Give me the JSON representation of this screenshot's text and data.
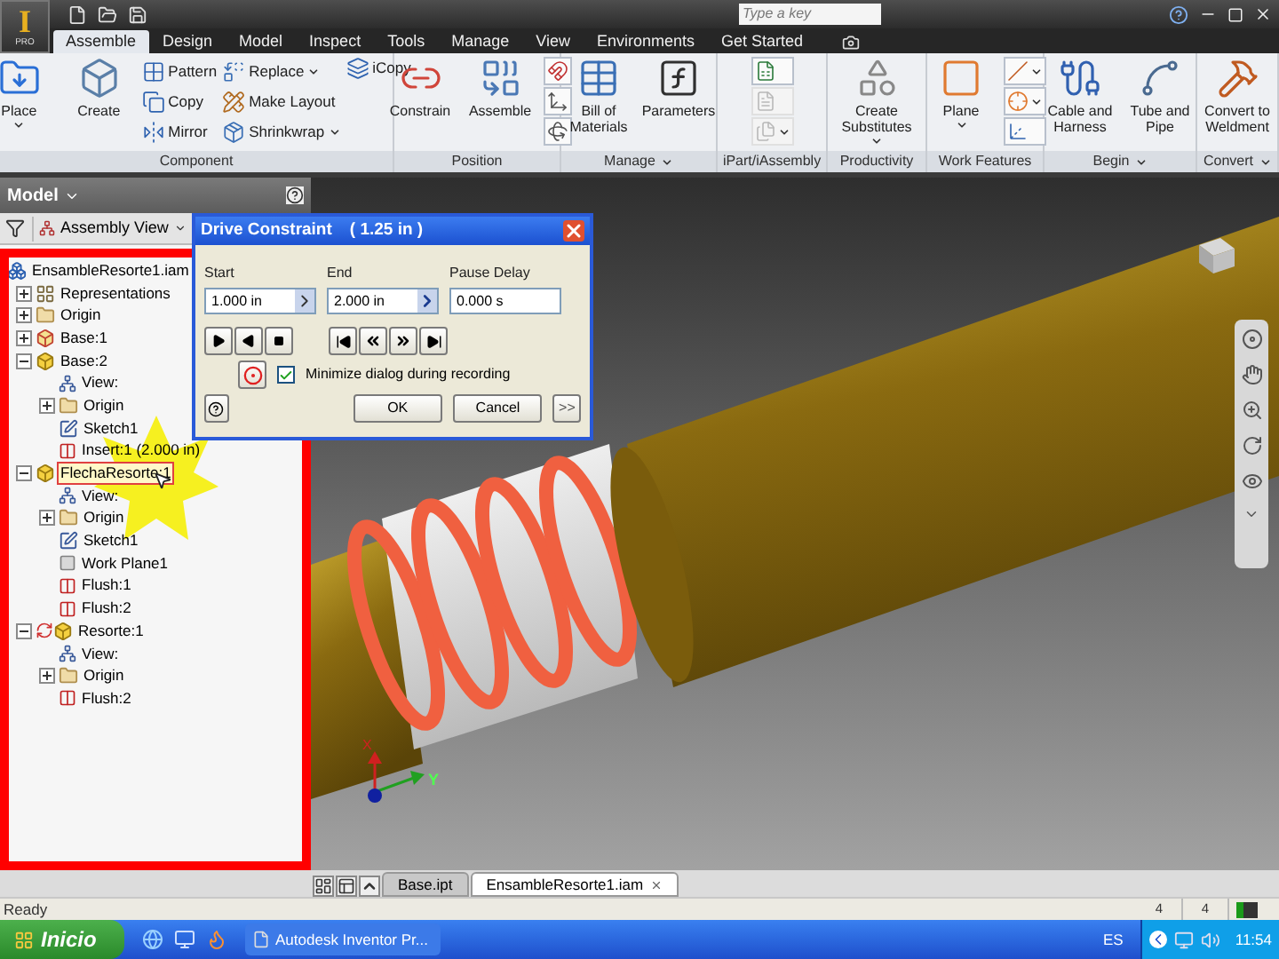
{
  "title_bar": {
    "app_button": {
      "letter": "I",
      "edition": "PRO"
    },
    "search": {
      "placeholder": "Type a key"
    }
  },
  "ribbon_tabs": [
    {
      "label": "Assemble",
      "selected": true
    },
    {
      "label": "Design",
      "selected": false
    },
    {
      "label": "Model",
      "selected": false
    },
    {
      "label": "Inspect",
      "selected": false
    },
    {
      "label": "Tools",
      "selected": false
    },
    {
      "label": "Manage",
      "selected": false
    },
    {
      "label": "View",
      "selected": false
    },
    {
      "label": "Environments",
      "selected": false
    },
    {
      "label": "Get Started",
      "selected": false
    }
  ],
  "ribbon_panels": [
    {
      "label": "Component",
      "menu": false,
      "columns": [
        [
          {
            "kind": "large",
            "label": "Place",
            "dropdown": true,
            "disabled": false
          }
        ],
        [
          {
            "kind": "large",
            "label": "Create",
            "dropdown": false,
            "disabled": false
          }
        ],
        [
          {
            "kind": "small",
            "label": "Pattern",
            "dropdown": false,
            "disabled": false
          },
          {
            "kind": "small",
            "label": "Copy",
            "dropdown": false,
            "disabled": false
          },
          {
            "kind": "small",
            "label": "Mirror",
            "dropdown": false,
            "disabled": false
          }
        ],
        [
          {
            "kind": "small",
            "label": "Replace",
            "dropdown": true,
            "disabled": false
          },
          {
            "kind": "small",
            "label": "Make Layout",
            "dropdown": false,
            "disabled": false
          },
          {
            "kind": "small",
            "label": "Shrinkwrap",
            "dropdown": true,
            "disabled": false
          }
        ],
        [
          {
            "kind": "small",
            "label": "iCopy",
            "dropdown": false,
            "disabled": false
          }
        ]
      ]
    },
    {
      "label": "Position",
      "menu": false,
      "columns": [
        [
          {
            "kind": "large",
            "label": "Constrain",
            "dropdown": false,
            "disabled": false
          }
        ],
        [
          {
            "kind": "large",
            "label": "Assemble",
            "dropdown": false,
            "disabled": false
          }
        ],
        [
          {
            "kind": "icon",
            "dropdown": false,
            "disabled": false
          },
          {
            "kind": "icon",
            "dropdown": false,
            "disabled": false
          },
          {
            "kind": "icon",
            "dropdown": false,
            "disabled": false
          }
        ]
      ]
    },
    {
      "label": "Manage",
      "menu": true,
      "columns": [
        [
          {
            "kind": "large",
            "label": "Bill of Materials",
            "dropdown": false,
            "disabled": false
          }
        ],
        [
          {
            "kind": "large",
            "label": "Parameters",
            "dropdown": false,
            "disabled": false
          }
        ]
      ]
    },
    {
      "label": "iPart/iAssembly",
      "menu": false,
      "columns": [
        [
          {
            "kind": "icon",
            "dropdown": false,
            "disabled": false
          },
          {
            "kind": "icon",
            "dropdown": false,
            "disabled": true
          },
          {
            "kind": "icon",
            "dropdown": true,
            "disabled": true
          }
        ]
      ]
    },
    {
      "label": "Productivity",
      "menu": false,
      "columns": [
        [
          {
            "kind": "large",
            "label": "Create Substitutes",
            "dropdown": true,
            "disabled": false
          }
        ]
      ]
    },
    {
      "label": "Work Features",
      "menu": false,
      "columns": [
        [
          {
            "kind": "large",
            "label": "Plane",
            "dropdown": true,
            "disabled": false
          }
        ],
        [
          {
            "kind": "icon",
            "dropdown": true,
            "disabled": false
          },
          {
            "kind": "icon",
            "dropdown": true,
            "disabled": false
          },
          {
            "kind": "icon",
            "dropdown": false,
            "disabled": false
          }
        ]
      ]
    },
    {
      "label": "Begin",
      "menu": true,
      "columns": [
        [
          {
            "kind": "large",
            "label": "Cable and Harness",
            "dropdown": false,
            "disabled": false
          }
        ],
        [
          {
            "kind": "large",
            "label": "Tube and Pipe",
            "dropdown": false,
            "disabled": false
          }
        ]
      ]
    },
    {
      "label": "Convert",
      "menu": true,
      "columns": [
        [
          {
            "kind": "large",
            "label": "Convert to Weldment",
            "dropdown": false,
            "disabled": false
          }
        ]
      ]
    }
  ],
  "browser": {
    "title": "Model",
    "view": "Assembly View",
    "tree": [
      {
        "label": "EnsambleResorte1.iam",
        "kind": "assembly",
        "selected": false,
        "children": [
          {
            "label": "Representations",
            "kind": "representations",
            "selected": false,
            "expanded": false
          },
          {
            "label": "Origin",
            "kind": "folder",
            "selected": false,
            "expanded": false
          },
          {
            "label": "Base:1",
            "kind": "grounded_part",
            "selected": false,
            "expanded": false
          },
          {
            "label": "Base:2",
            "kind": "part",
            "selected": false,
            "expanded": true,
            "children": [
              {
                "label": "View:",
                "kind": "view",
                "selected": false
              },
              {
                "label": "Origin",
                "kind": "folder",
                "selected": false,
                "expanded": false
              },
              {
                "label": "Sketch1",
                "kind": "sketch",
                "selected": false
              },
              {
                "label": "Insert:1 (2.000 in)",
                "kind": "constraint",
                "selected": false
              }
            ]
          },
          {
            "label": "FlechaResorte:1",
            "kind": "part",
            "selected": true,
            "expanded": true,
            "children": [
              {
                "label": "View:",
                "kind": "view",
                "selected": false
              },
              {
                "label": "Origin",
                "kind": "folder",
                "selected": false,
                "expanded": false
              },
              {
                "label": "Sketch1",
                "kind": "sketch",
                "selected": false
              },
              {
                "label": "Work Plane1",
                "kind": "workplane",
                "selected": false
              },
              {
                "label": "Flush:1",
                "kind": "constraint",
                "selected": false
              },
              {
                "label": "Flush:2",
                "kind": "constraint",
                "selected": false
              }
            ]
          },
          {
            "label": "Resorte:1",
            "kind": "adaptive_part",
            "selected": false,
            "expanded": true,
            "children": [
              {
                "label": "View:",
                "kind": "view",
                "selected": false
              },
              {
                "label": "Origin",
                "kind": "folder",
                "selected": false,
                "expanded": false
              },
              {
                "label": "Flush:2",
                "kind": "constraint",
                "selected": false
              }
            ]
          }
        ]
      }
    ]
  },
  "viewport": {
    "axis_labels": [
      "X",
      "Y"
    ]
  },
  "dialog": {
    "title": "Drive Constraint",
    "value": "( 1.25 in )",
    "fields": [
      {
        "label": "Start",
        "value": "1.000 in",
        "kind": "stepper"
      },
      {
        "label": "End",
        "value": "2.000 in",
        "kind": "arrow"
      },
      {
        "label": "Pause Delay",
        "value": "0.000 s",
        "kind": "plain"
      }
    ],
    "minimize_option": {
      "label": "Minimize dialog during recording",
      "checked": true
    },
    "buttons": [
      "OK",
      "Cancel"
    ],
    "more_button": ">>"
  },
  "document_tabs": [
    {
      "label": "Base.ipt",
      "selected": false
    },
    {
      "label": "EnsambleResorte1.iam",
      "selected": true
    }
  ],
  "status_bar": {
    "message": "Ready",
    "fields": [
      "4",
      "4"
    ]
  },
  "taskbar": {
    "start": "Inicio",
    "tasks": [
      {
        "label": "Autodesk Inventor Pr...",
        "selected": false
      }
    ],
    "language": "ES",
    "clock": "11:54"
  }
}
